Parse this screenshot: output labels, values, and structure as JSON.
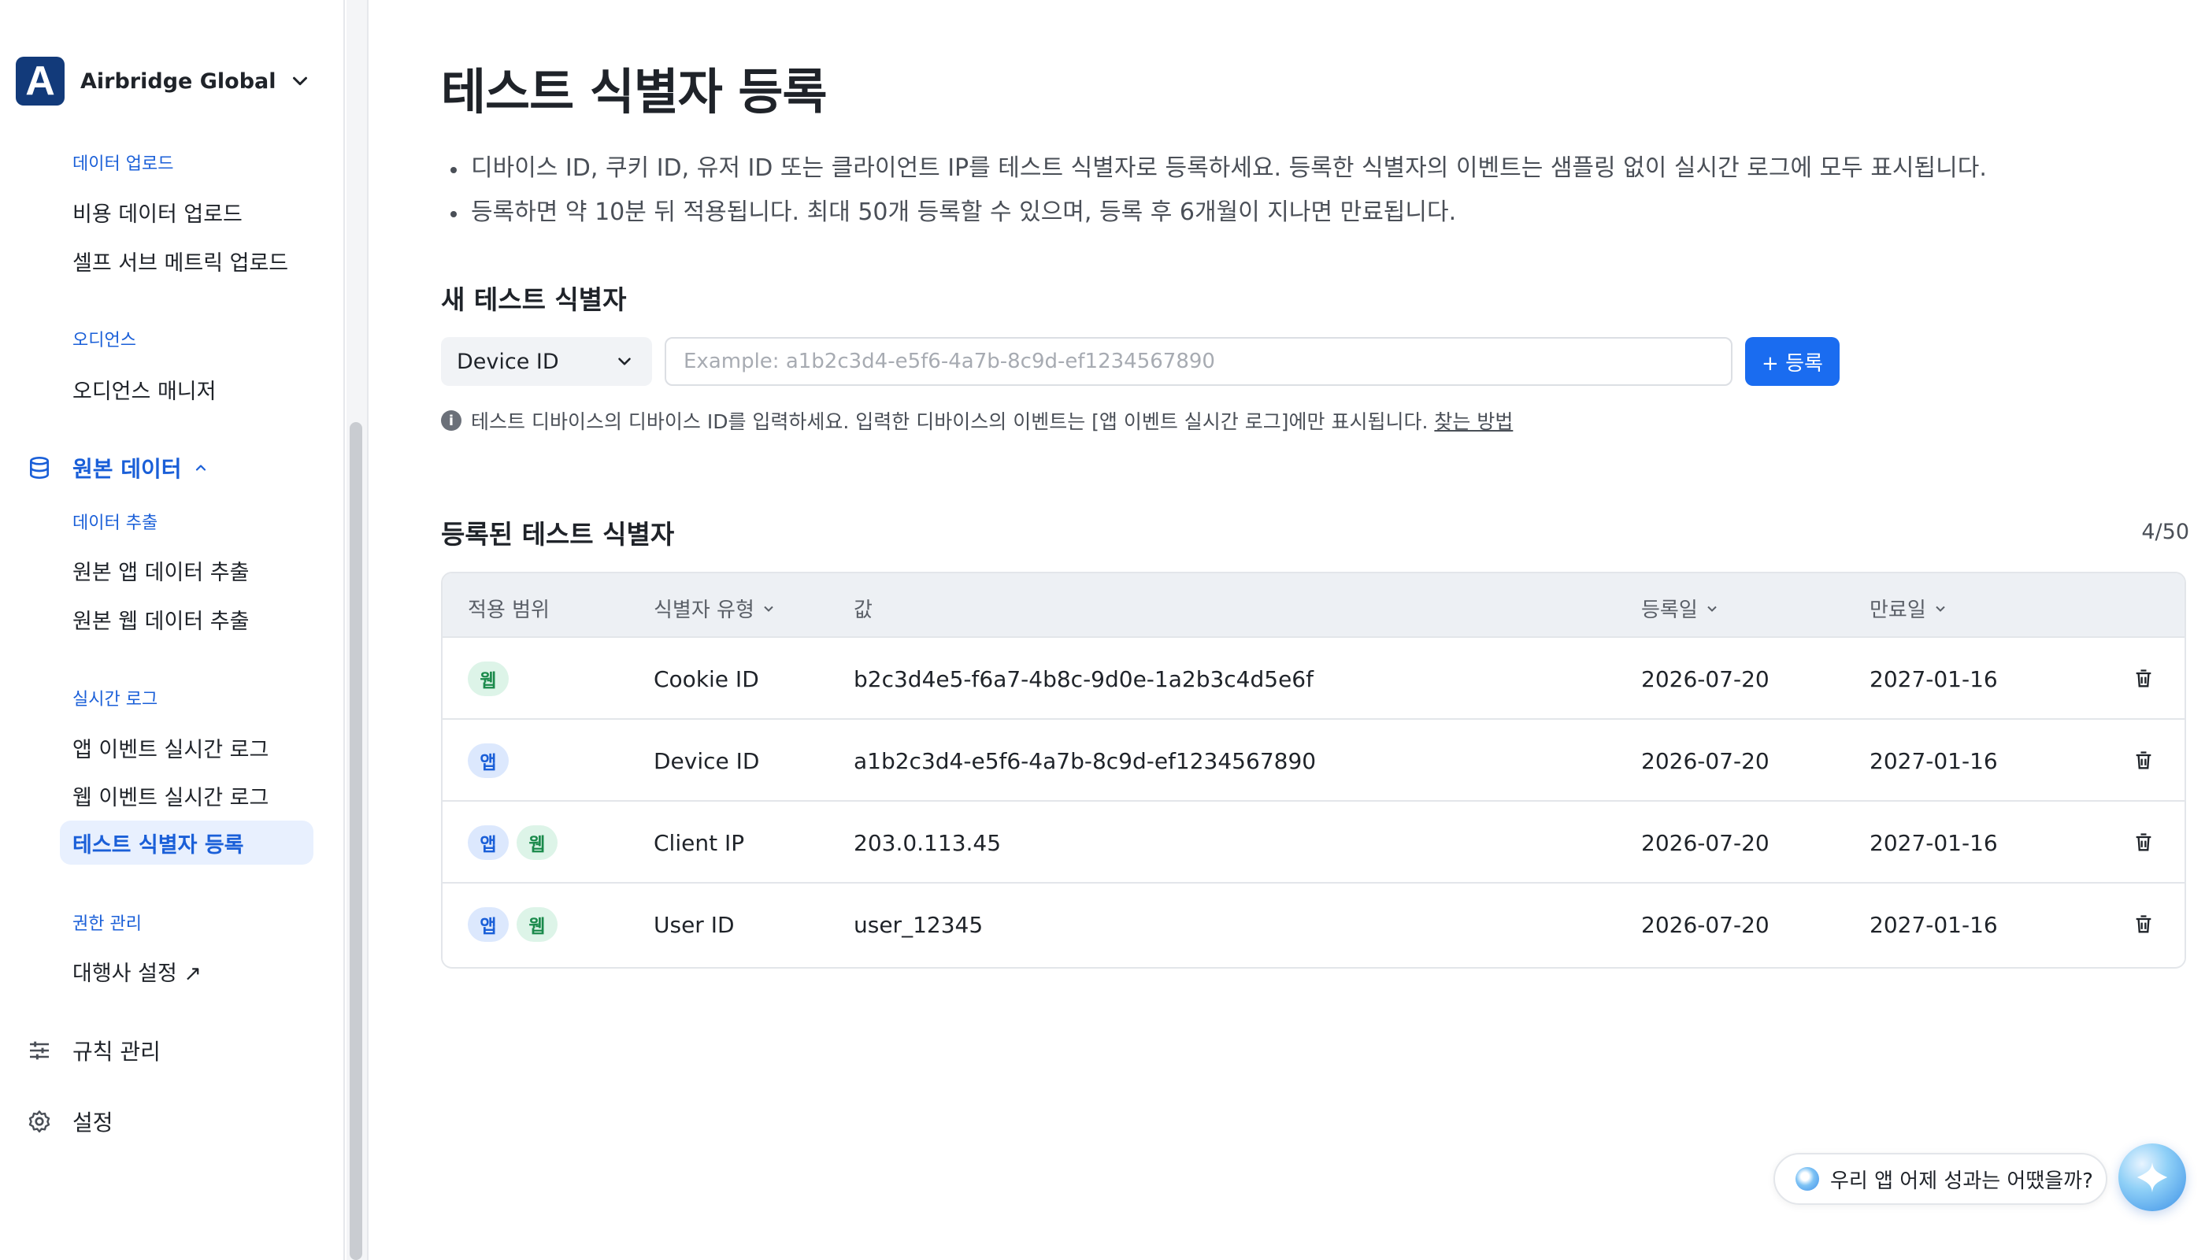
{
  "org": {
    "logo_letter": "A",
    "name": "Airbridge Global"
  },
  "sidebar": {
    "groups": {
      "data_upload": "데이터 업로드",
      "audience": "오디언스",
      "data_extract": "데이터 추출",
      "realtime_log": "실시간 로그",
      "permission": "권한 관리"
    },
    "items": {
      "cost_upload": "비용 데이터 업로드",
      "self_serve_upload": "셀프 서브 메트릭 업로드",
      "audience_manager": "오디언스 매니저",
      "raw_app_extract": "원본 앱 데이터 추출",
      "raw_web_extract": "원본 웹 데이터 추출",
      "app_event_log": "앱 이벤트 실시간 로그",
      "web_event_log": "웹 이벤트 실시간 로그",
      "test_identifier": "테스트 식별자 등록",
      "agency_settings": "대행사 설정 ↗"
    },
    "main": {
      "raw_data": "원본 데이터",
      "rules": "규칙 관리",
      "settings": "설정"
    }
  },
  "page": {
    "title": "테스트 식별자 등록",
    "bullets": [
      "디바이스 ID, 쿠키 ID, 유저 ID 또는 클라이언트 IP를 테스트 식별자로 등록하세요. 등록한 식별자의 이벤트는 샘플링 없이 실시간 로그에 모두 표시됩니다.",
      "등록하면 약 10분 뒤 적용됩니다. 최대 50개 등록할 수 있으며, 등록 후 6개월이 지나면 만료됩니다."
    ],
    "new_section_title": "새 테스트 식별자",
    "type_select_value": "Device ID",
    "input_placeholder": "Example: a1b2c3d4-e5f6-4a7b-8c9d-ef1234567890",
    "register_button": "+ 등록",
    "help_text": "테스트 디바이스의 디바이스 ID를 입력하세요. 입력한 디바이스의 이벤트는 [앱 이벤트 실시간 로그]에만 표시됩니다.",
    "help_link": "찾는 방법",
    "registered_title": "등록된 테스트 식별자",
    "count": "4/50"
  },
  "table": {
    "headers": {
      "scope": "적용 범위",
      "type": "식별자 유형",
      "value": "값",
      "registered": "등록일",
      "expires": "만료일"
    },
    "rows": [
      {
        "scope": [
          "웹"
        ],
        "type": "Cookie ID",
        "value": "b2c3d4e5-f6a7-4b8c-9d0e-1a2b3c4d5e6f",
        "registered": "2026-07-20",
        "expires": "2027-01-16"
      },
      {
        "scope": [
          "앱"
        ],
        "type": "Device ID",
        "value": "a1b2c3d4-e5f6-4a7b-8c9d-ef1234567890",
        "registered": "2026-07-20",
        "expires": "2027-01-16"
      },
      {
        "scope": [
          "앱",
          "웹"
        ],
        "type": "Client IP",
        "value": "203.0.113.45",
        "registered": "2026-07-20",
        "expires": "2027-01-16"
      },
      {
        "scope": [
          "앱",
          "웹"
        ],
        "type": "User ID",
        "value": "user_12345",
        "registered": "2026-07-20",
        "expires": "2027-01-16"
      }
    ]
  },
  "floating": {
    "ask_text": "우리 앱 어제 성과는 어땠을까?"
  },
  "colors": {
    "accent": "#1a5fd8",
    "web_badge": "#1a8a4b",
    "app_badge": "#1a5fd8",
    "org_logo": "#123a7a"
  }
}
